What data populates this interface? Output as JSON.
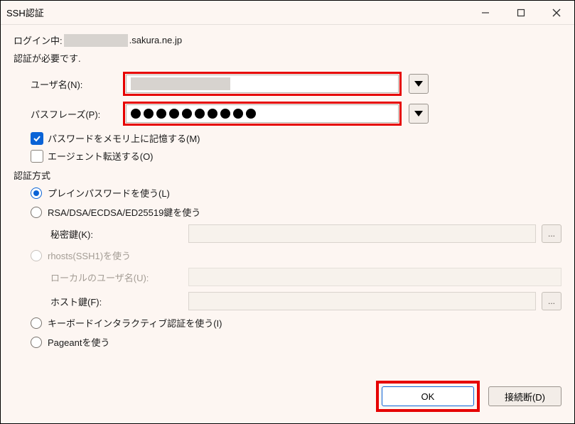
{
  "window": {
    "title": "SSH認証",
    "minimize_label": "Minimize",
    "maximize_label": "Maximize",
    "close_label": "Close"
  },
  "login": {
    "prefix": "ログイン中:",
    "host_visible": ".sakura.ne.jp"
  },
  "auth_needed": "認証が必要です.",
  "fields": {
    "username_label": "ユーザ名(N):",
    "passphrase_label": "パスフレーズ(P):"
  },
  "passphrase_dots": 10,
  "checkboxes": {
    "remember_password": "パスワードをメモリ上に記憶する(M)",
    "agent_forward": "エージェント転送する(O)"
  },
  "auth_method_group": "認証方式",
  "radios": {
    "plain_password": "プレインパスワードを使う(L)",
    "rsa_dsa": "RSA/DSA/ECDSA/ED25519鍵を使う",
    "rhosts": "rhosts(SSH1)を使う",
    "keyboard_interactive": "キーボードインタラクティブ認証を使う(I)",
    "pageant": "Pageantを使う"
  },
  "sublabels": {
    "private_key": "秘密鍵(K):",
    "local_user": "ローカルのユーザ名(U):",
    "host_key": "ホスト鍵(F):"
  },
  "buttons": {
    "browse": "...",
    "ok": "OK",
    "disconnect": "接続断(D)"
  }
}
